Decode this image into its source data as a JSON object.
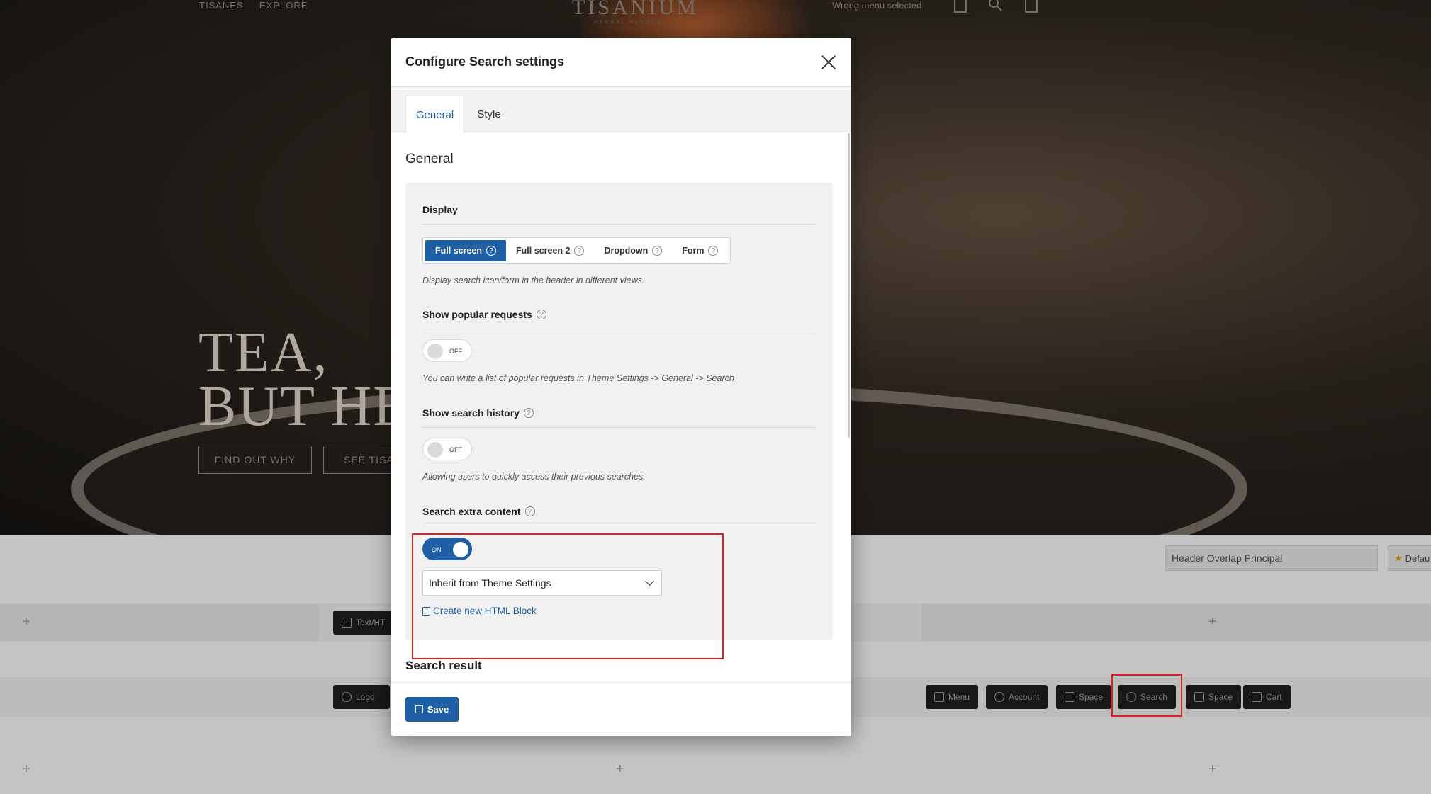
{
  "background": {
    "nav_left": [
      "TISANES",
      "EXPLORE"
    ],
    "brand": "TISANIUM",
    "brand_sub": "HERBAL BLENDS",
    "wrong_menu": "Wrong menu selected",
    "headline_line1": "TEA,",
    "headline_line2": "BUT HE",
    "hero_buttons": [
      "FIND OUT WHY",
      "SEE TISA"
    ],
    "header_overlap": "Header Overlap Principal",
    "header_default": "Defau",
    "builder_buttons": {
      "text_html": "Text/HT",
      "logo": "Logo",
      "menu": "Menu",
      "account": "Account",
      "space1": "Space",
      "search": "Search",
      "space2": "Space",
      "cart": "Cart"
    },
    "plus": "+"
  },
  "modal": {
    "title": "Configure Search settings",
    "tabs": [
      {
        "label": "General",
        "active": true
      },
      {
        "label": "Style",
        "active": false
      }
    ],
    "section_heading": "General",
    "display": {
      "title": "Display",
      "options": [
        {
          "label": "Full screen",
          "active": true
        },
        {
          "label": "Full screen 2",
          "active": false
        },
        {
          "label": "Dropdown",
          "active": false
        },
        {
          "label": "Form",
          "active": false
        }
      ],
      "description": "Display search icon/form in the header in different views."
    },
    "popular": {
      "title": "Show popular requests",
      "toggle": "OFF",
      "description": "You can write a list of popular requests in Theme Settings -> General -> Search"
    },
    "history": {
      "title": "Show search history",
      "toggle": "OFF",
      "description": "Allowing users to quickly access their previous searches."
    },
    "extra": {
      "title": "Search extra content",
      "toggle": "ON",
      "select_value": "Inherit from Theme Settings",
      "create_link": "Create new HTML Block"
    },
    "result_heading": "Search result",
    "save_label": "Save",
    "help_glyph": "?"
  },
  "colors": {
    "accent": "#1f5fa6",
    "highlight": "#e02020"
  }
}
